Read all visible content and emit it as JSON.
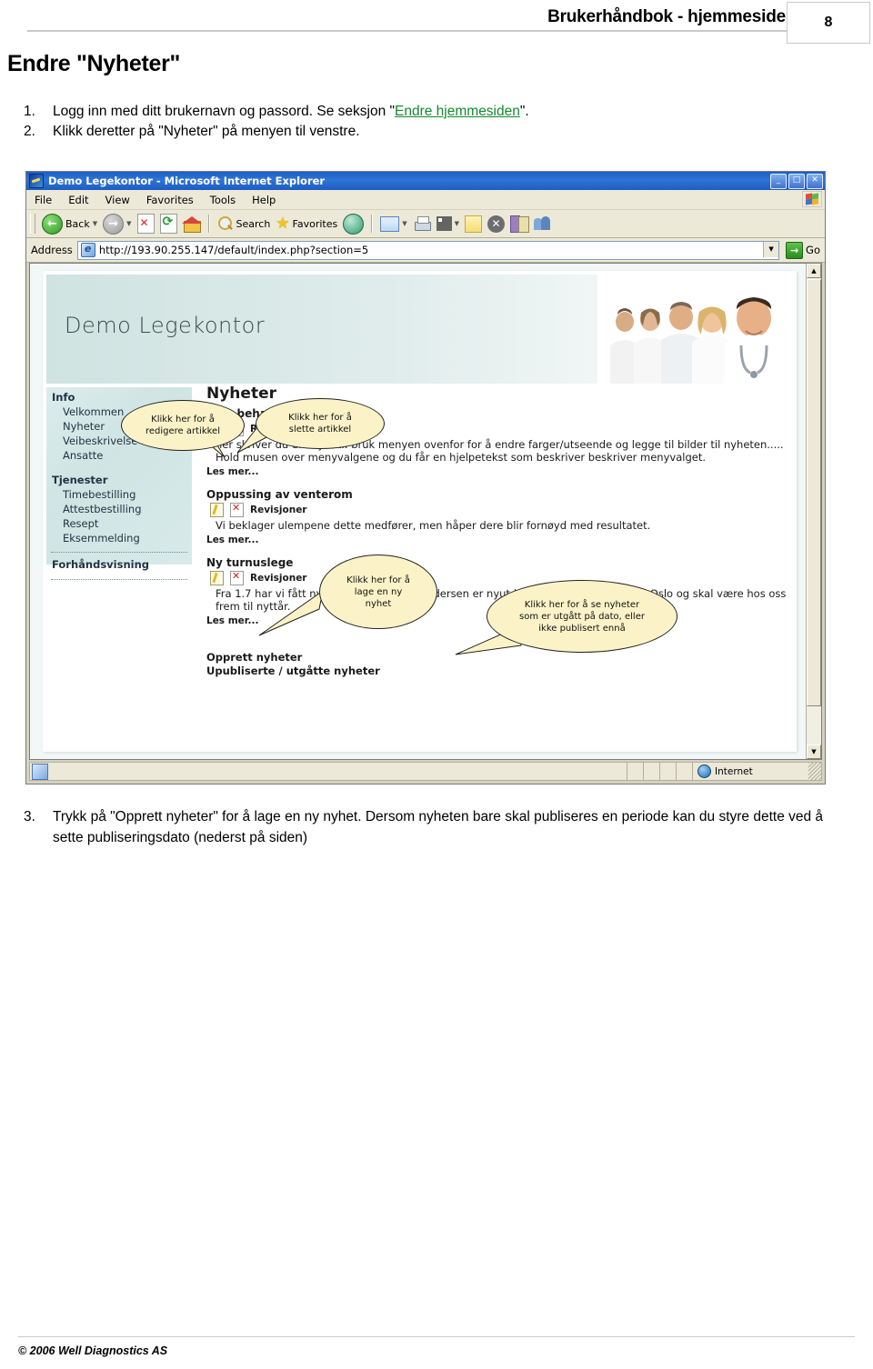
{
  "header": {
    "title": "Brukerhåndbok - hjemmeside",
    "page_number": "8"
  },
  "section_title": "Endre \"Nyheter\"",
  "steps_top": [
    {
      "num": "1.",
      "text_before": "Logg inn med ditt brukernavn og passord. Se seksjon \"",
      "link": "Endre hjemmesiden",
      "text_after": "\"."
    },
    {
      "num": "2.",
      "text_before": "Klikk deretter på \"Nyheter\" på menyen til venstre.",
      "link": "",
      "text_after": ""
    }
  ],
  "steps_bottom": [
    {
      "num": "3.",
      "text": "Trykk på \"Opprett nyheter\" for å lage en ny nyhet. Dersom nyheten bare skal publiseres en periode kan du styre dette ved å sette publiseringsdato (nederst på siden)"
    }
  ],
  "footer": {
    "copyright": "© 2006 Well Diagnostics AS"
  },
  "browser": {
    "window_title": "Demo Legekontor - Microsoft Internet Explorer",
    "window_buttons": {
      "minimize": "_",
      "maximize": "□",
      "close": "✕"
    },
    "menu": [
      "File",
      "Edit",
      "View",
      "Favorites",
      "Tools",
      "Help"
    ],
    "toolbar": {
      "back_label": "Back",
      "search_label": "Search",
      "favorites_label": "Favorites"
    },
    "address": {
      "label": "Address",
      "url": "http://193.90.255.147/default/index.php?section=5",
      "go_label": "Go"
    },
    "status": {
      "zone": "Internet"
    }
  },
  "site": {
    "banner_title": "Demo Legekontor",
    "sidebar": {
      "heading_info": "Info",
      "items_info": [
        "Velkommen",
        "Nyheter",
        "Veibeskrivelse",
        "Ansatte"
      ],
      "heading_services": "Tjenester",
      "items_services": [
        "Timebestilling",
        "Attestbestilling",
        "Resept",
        "Eksemmelding"
      ],
      "preview": "Forhåndsvisning"
    },
    "news_heading": "Nyheter",
    "revisions_label": "Revisjoner",
    "read_more_label": "Les mer...",
    "articles": [
      {
        "title": "Nytt behandlingstilbud",
        "body": "her skriver du din nyhet.. bruk menyen ovenfor for å endre farger/utseende og legge til bilder til nyheten..... Hold musen over menyvalgene og du får en hjelpetekst som beskriver beskriver menyvalget."
      },
      {
        "title": "Oppussing av venterom",
        "body": "Vi beklager ulempene dette medfører, men håper dere blir fornøyd med resultatet."
      },
      {
        "title": "Ny turnuslege",
        "body": "Fra 1.7 har vi fått ny turnuslege. Jonas Andersen er nyutdannet ved Universitetet i Oslo og skal være hos oss frem til nyttår."
      }
    ],
    "bottom_links": [
      "Opprett nyheter",
      "Upubliserte / utgåtte nyheter"
    ]
  },
  "callouts": [
    {
      "id": "edit-article",
      "lines": [
        "Klikk her for å",
        "redigere artikkel"
      ]
    },
    {
      "id": "delete-article",
      "lines": [
        "Klikk her for å",
        "slette artikkel"
      ]
    },
    {
      "id": "create-news",
      "lines": [
        "Klikk her for å",
        "lage en ny",
        "nyhet"
      ]
    },
    {
      "id": "expired-news",
      "lines": [
        "Klikk her for å se nyheter",
        "som er utgått på dato, eller",
        "ikke publisert ennå"
      ]
    }
  ],
  "colors": {
    "link_green": "#128a2e",
    "banner_teal": "#cfe3e1",
    "callout_yellow": "#fbf3c7",
    "title_blue": "#1d5fc4"
  }
}
